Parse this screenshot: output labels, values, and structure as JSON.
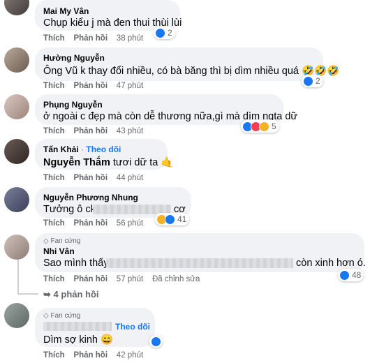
{
  "comments": [
    {
      "name": "Mai My Vân",
      "text": "Chụp kiểu j mà đen thui thùi lùi",
      "like": "Thích",
      "reply": "Phản hồi",
      "time": "38 phút",
      "count": "2"
    },
    {
      "name": "Hường Nguyễn",
      "text": "Ông Vũ k thay đổi nhiều, có bà băng thì bị dìm nhiều quá 🤣🤣🤣",
      "like": "Thích",
      "reply": "Phản hồi",
      "time": "47 phút",
      "count": "2"
    },
    {
      "name": "Phụng Nguyễn",
      "text": "ở ngoài c đẹp mà còn dễ thương nữa,gì mà dìm ngta dữ",
      "like": "Thích",
      "reply": "Phản hồi",
      "time": "43 phút",
      "count": "5"
    },
    {
      "name": "Tấn Khải",
      "follow": "Theo dõi",
      "mention": "Nguyễn Thắm",
      "text": "tươi dữ ta 🤙",
      "like": "Thích",
      "reply": "Phản hồi",
      "time": "44 phút"
    },
    {
      "name": "Nguyễn Phương Nhung",
      "text_start": "Tưởng ô ck",
      "text_end": "cơ",
      "like": "Thích",
      "reply": "Phản hồi",
      "time": "56 phút",
      "count": "41"
    },
    {
      "badge": "Fan cứng",
      "name": "Nhi Vân",
      "text_start": "Sao mình thấy",
      "text_end": "còn xinh hơn ó.",
      "like": "Thích",
      "reply": "Phản hồi",
      "time": "57 phút",
      "edited": "Đã chỉnh sửa",
      "count": "48"
    }
  ],
  "view_replies": "4 phản hồi",
  "reply": {
    "badge": "Fan cứng",
    "follow": "Theo dõi",
    "text": "Dìm sợ kinh 😄",
    "like": "Thích",
    "reply": "Phản hồi",
    "time": "42 phút"
  },
  "colors": {
    "link": "#1877f2",
    "bubble": "#f0f2f5",
    "meta": "#65676b"
  }
}
